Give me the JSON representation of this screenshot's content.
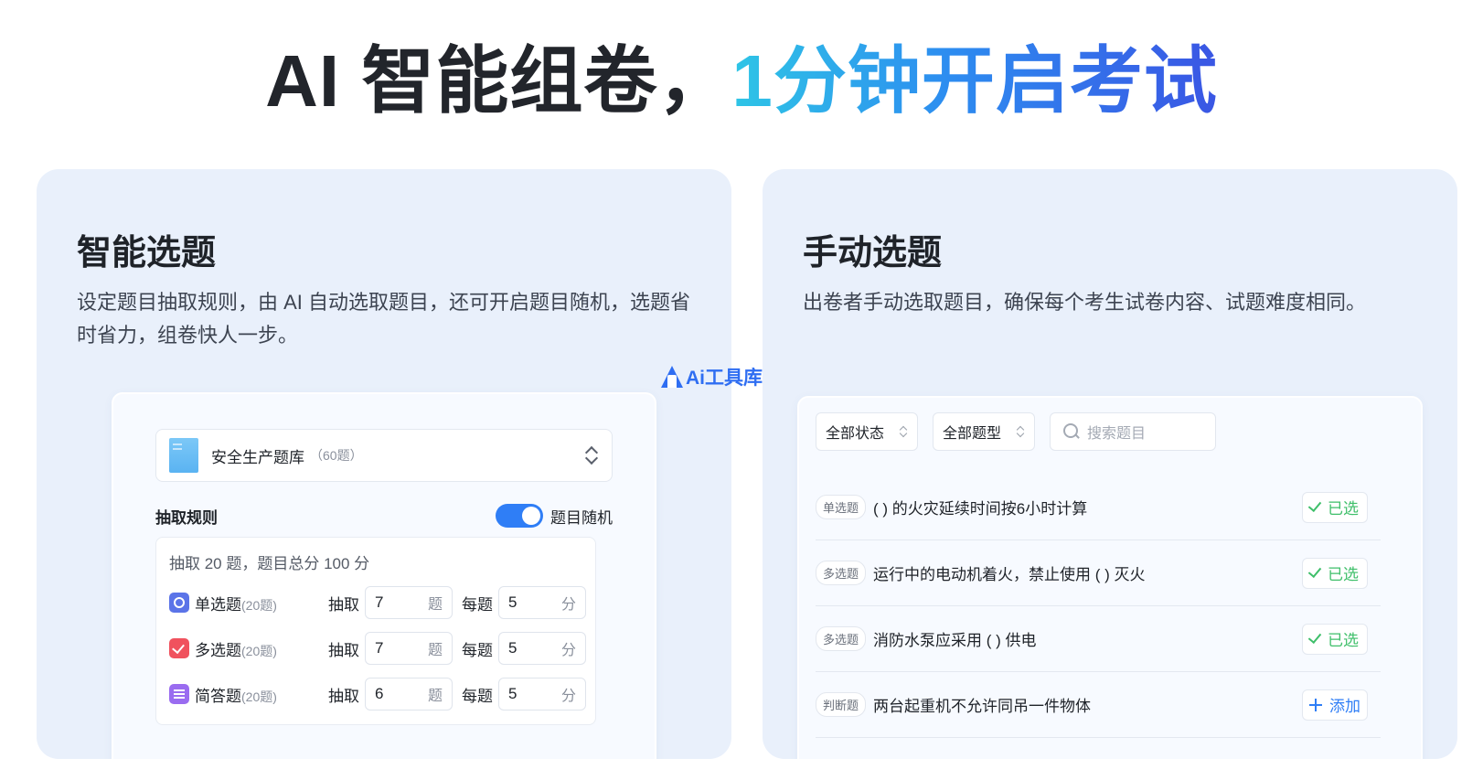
{
  "headline": {
    "dark": "AI 智能组卷，",
    "accent": "1分钟开启考试"
  },
  "watermark": "Ai工具库",
  "smart": {
    "title": "智能选题",
    "desc": "设定题目抽取规则，由 AI 自动选取题目，还可开启题目随机，选题省时省力，组卷快人一步。",
    "bank": {
      "name": "安全生产题库",
      "count": "（60题）"
    },
    "rule_title": "抽取规则",
    "random_label": "题目随机",
    "random_on": true,
    "summary": "抽取 20 题，题目总分 100 分",
    "draw_label": "抽取",
    "per_label": "每题",
    "count_unit": "题",
    "score_unit": "分",
    "rows": [
      {
        "name": "单选题",
        "count": "(20题)",
        "draw": "7",
        "score": "5"
      },
      {
        "name": "多选题",
        "count": "(20题)",
        "draw": "7",
        "score": "5"
      },
      {
        "name": "简答题",
        "count": "(20题)",
        "draw": "6",
        "score": "5"
      }
    ]
  },
  "manual": {
    "title": "手动选题",
    "desc": "出卷者手动选取题目，确保每个考生试卷内容、试题难度相同。",
    "filter_status": "全部状态",
    "filter_type": "全部题型",
    "search_placeholder": "搜索题目",
    "questions": [
      {
        "tag": "单选题",
        "text": "( ) 的火灾延续时间按6小时计算",
        "action": "已选"
      },
      {
        "tag": "多选题",
        "text": "运行中的电动机着火，禁止使用 ( ) 灭火",
        "action": "已选"
      },
      {
        "tag": "多选题",
        "text": "消防水泵应采用 ( ) 供电",
        "action": "已选"
      },
      {
        "tag": "判断题",
        "text": "两台起重机不允许同吊一件物体",
        "action": "添加"
      }
    ]
  }
}
